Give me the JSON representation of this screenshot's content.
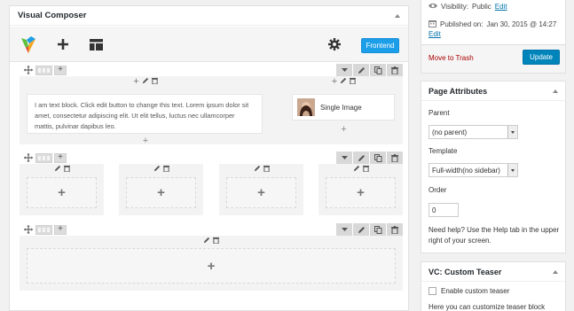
{
  "visual_composer": {
    "title": "Visual Composer",
    "frontend_label": "Frontend",
    "text_block": "I am text block. Click edit button to change this text. Lorem ipsum dolor sit amet, consectetur adipiscing elit. Ut elit tellus, luctus nec ullamcorper mattis, pulvinar dapibus leo.",
    "single_image_label": "Single Image"
  },
  "publish": {
    "visibility_label": "Visibility:",
    "visibility_value": "Public",
    "visibility_edit": "Edit",
    "published_label": "Published on:",
    "published_value": "Jan 30, 2015 @ 14:27",
    "published_edit": "Edit",
    "trash_label": "Move to Trash",
    "update_label": "Update"
  },
  "page_attributes": {
    "title": "Page Attributes",
    "parent_label": "Parent",
    "parent_value": "(no parent)",
    "template_label": "Template",
    "template_value": "Full-width(no sidebar)",
    "order_label": "Order",
    "order_value": "0",
    "help_text": "Need help? Use the Help tab in the upper right of your screen."
  },
  "custom_teaser": {
    "title": "VC: Custom Teaser",
    "checkbox_label": "Enable custom teaser",
    "help_text": "Here you can customize teaser block"
  },
  "colors": {
    "accent": "#1d9ee8",
    "update": "#0085ba",
    "trash": "#a00"
  }
}
